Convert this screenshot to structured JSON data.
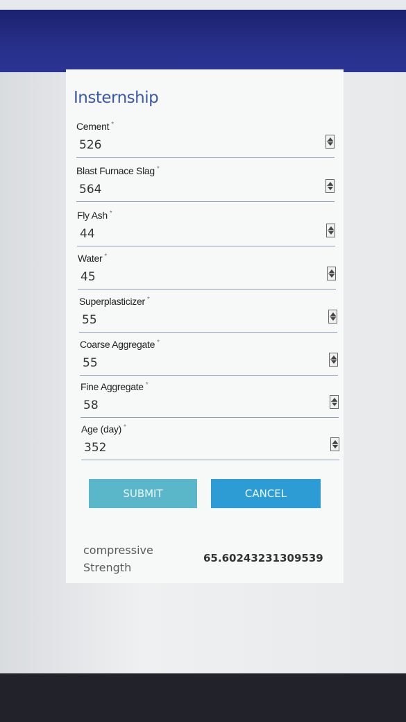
{
  "form": {
    "title": "Insternship",
    "fields": [
      {
        "label": "Cement",
        "value": "526"
      },
      {
        "label": "Blast Furnace Slag",
        "value": "564"
      },
      {
        "label": "Fly Ash",
        "value": "44"
      },
      {
        "label": "Water",
        "value": "45"
      },
      {
        "label": "Superplasticizer",
        "value": "55"
      },
      {
        "label": "Coarse Aggregate",
        "value": "55"
      },
      {
        "label": "Fine Aggregate",
        "value": "58"
      },
      {
        "label": "Age (day)",
        "value": "352"
      }
    ],
    "required_marker": "*"
  },
  "buttons": {
    "submit_label": "SUBMIT",
    "cancel_label": "CANCEL"
  },
  "result": {
    "label": "compressive Strength",
    "value": "65.60243231309539"
  },
  "colors": {
    "title": "#3a5aa8",
    "submit": "#5ab6c9",
    "cancel": "#2d9bd4",
    "header": "#27308a"
  }
}
